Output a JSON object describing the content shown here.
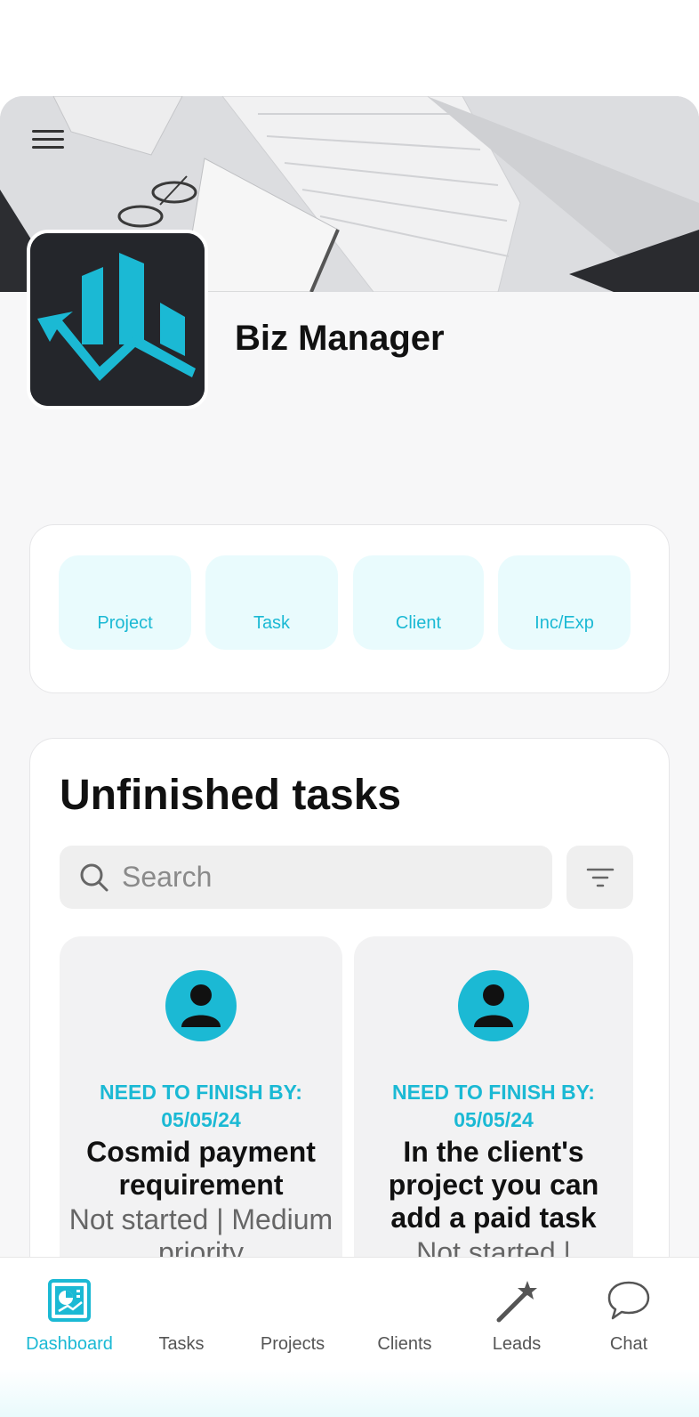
{
  "header": {
    "app_title": "Biz Manager"
  },
  "quick_actions": [
    {
      "label": "Project"
    },
    {
      "label": "Task"
    },
    {
      "label": "Client"
    },
    {
      "label": "Inc/Exp"
    }
  ],
  "tasks_section": {
    "title": "Unfinished tasks",
    "search_placeholder": "Search",
    "tasks": [
      {
        "due": "NEED TO FINISH BY: 05/05/24",
        "name": "Cosmid payment requirement",
        "status": "Not started | Medium priority"
      },
      {
        "due": "NEED TO FINISH BY: 05/05/24",
        "name": "In the client's project you can add a paid task",
        "status": "Not started |"
      }
    ]
  },
  "bottom_nav": [
    {
      "label": "Dashboard",
      "icon": "dashboard-icon",
      "active": true
    },
    {
      "label": "Tasks",
      "icon": "tasks-icon"
    },
    {
      "label": "Projects",
      "icon": "projects-icon"
    },
    {
      "label": "Clients",
      "icon": "clients-icon"
    },
    {
      "label": "Leads",
      "icon": "magic-wand-icon"
    },
    {
      "label": "Chat",
      "icon": "chat-bubble-icon"
    }
  ],
  "colors": {
    "accent": "#1bb9d4",
    "logo_bg": "#24262b"
  }
}
